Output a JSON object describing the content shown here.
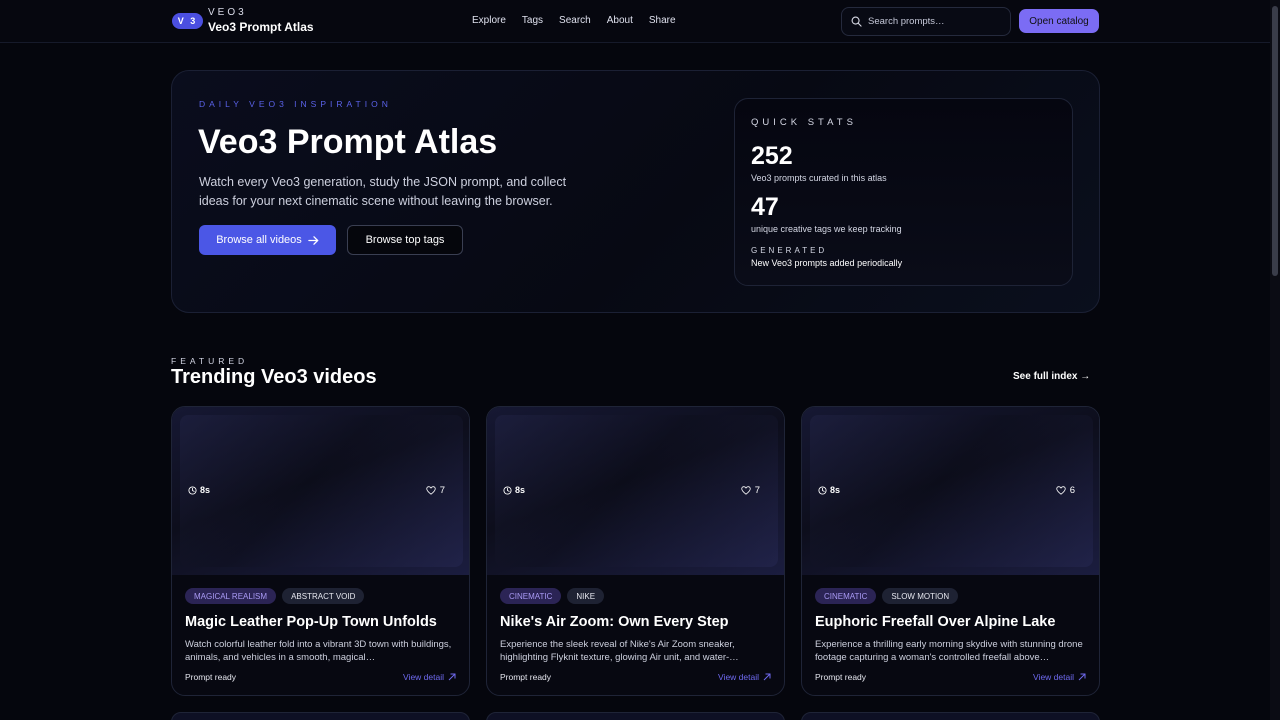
{
  "header": {
    "badge": "V 3",
    "eyebrow": "VEO3",
    "title": "Veo3 Prompt Atlas",
    "nav": [
      "Explore",
      "Tags",
      "Search",
      "About",
      "Share"
    ],
    "search_placeholder": "Search prompts…",
    "cta": "Open catalog"
  },
  "hero": {
    "eyebrow": "DAILY VEO3 INSPIRATION",
    "title": "Veo3 Prompt Atlas",
    "description": "Watch every Veo3 generation, study the JSON prompt, and collect ideas for your next cinematic scene without leaving the browser.",
    "primary_button": "Browse all videos",
    "secondary_button": "Browse top tags",
    "stats": {
      "label": "QUICK STATS",
      "prompts_count": "252",
      "prompts_caption": "Veo3 prompts curated in this atlas",
      "tags_count": "47",
      "tags_caption": "unique creative tags we keep tracking",
      "generated_label": "GENERATED",
      "generated_caption": "New Veo3 prompts added periodically"
    }
  },
  "featured": {
    "eyebrow": "FEATURED",
    "title": "Trending Veo3 videos",
    "see_index": "See full index →",
    "cards": [
      {
        "duration": "8s",
        "likes": "7",
        "tags": [
          "MAGICAL REALISM",
          "ABSTRACT VOID"
        ],
        "title": "Magic Leather Pop-Up Town Unfolds",
        "description": "Watch colorful leather fold into a vibrant 3D town with buildings, animals, and vehicles in a smooth, magical…",
        "status": "Prompt ready",
        "link": "View detail"
      },
      {
        "duration": "8s",
        "likes": "7",
        "tags": [
          "CINEMATIC",
          "NIKE"
        ],
        "title": "Nike's Air Zoom: Own Every Step",
        "description": "Experience the sleek reveal of Nike's Air Zoom sneaker, highlighting Flyknit texture, glowing Air unit, and water-…",
        "status": "Prompt ready",
        "link": "View detail"
      },
      {
        "duration": "8s",
        "likes": "6",
        "tags": [
          "CINEMATIC",
          "SLOW MOTION"
        ],
        "title": "Euphoric Freefall Over Alpine Lake",
        "description": "Experience a thrilling early morning skydive with stunning drone footage capturing a woman's controlled freefall above…",
        "status": "Prompt ready",
        "link": "View detail"
      }
    ]
  },
  "colors": {
    "accent": "#4b57e6",
    "cta": "#7b6cf4",
    "tag_primary_text": "#a99af5",
    "background": "#05060d"
  }
}
